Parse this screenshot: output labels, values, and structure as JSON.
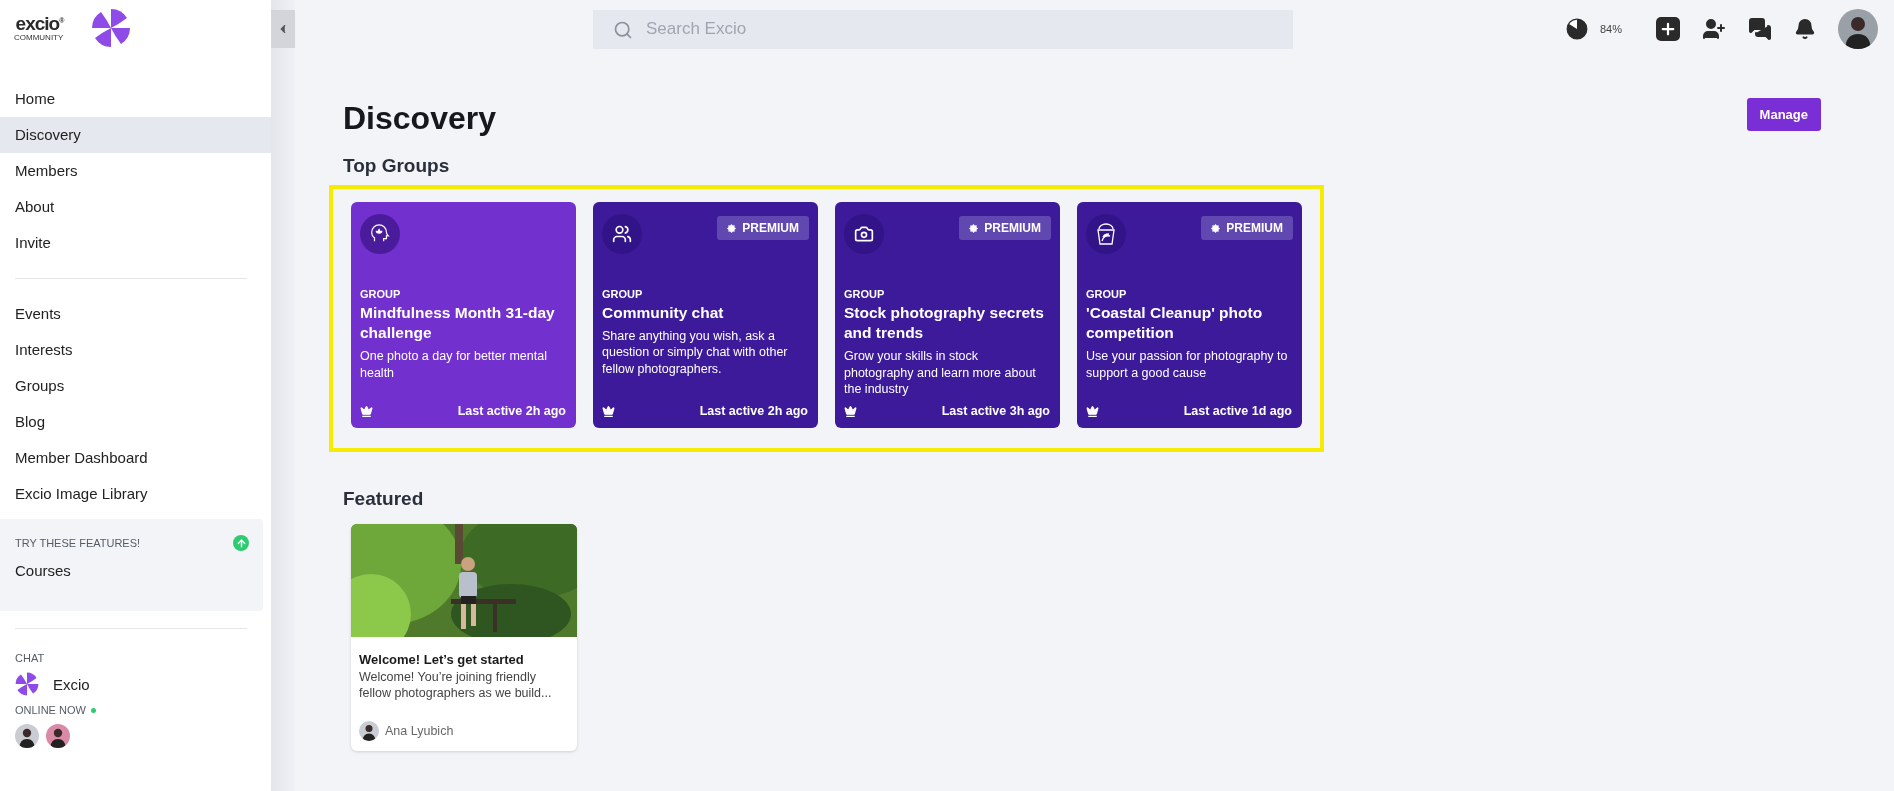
{
  "sidebar": {
    "logo": {
      "wordmark": "excio$^{®}$",
      "tagline": "COMMUNITY"
    },
    "nav_primary": [
      {
        "label": "Home",
        "selected": false
      },
      {
        "label": "Discovery",
        "selected": true
      },
      {
        "label": "Members",
        "selected": false
      },
      {
        "label": "About",
        "selected": false
      },
      {
        "label": "Invite",
        "selected": false
      }
    ],
    "nav_secondary": [
      {
        "label": "Events",
        "selected": false
      },
      {
        "label": "Interests",
        "selected": false
      },
      {
        "label": "Groups",
        "selected": false
      },
      {
        "label": "Blog",
        "selected": false
      },
      {
        "label": "Member Dashboard",
        "selected": false
      },
      {
        "label": "Excio Image Library",
        "selected": false
      }
    ],
    "features": {
      "heading": "TRY THESE FEATURES!",
      "items": [
        {
          "label": "Courses"
        }
      ]
    },
    "chat": {
      "heading": "CHAT",
      "channels": [
        {
          "name": "Excio"
        }
      ]
    },
    "online": {
      "heading": "ONLINE NOW"
    }
  },
  "topbar": {
    "search": {
      "placeholder": "Search Excio"
    },
    "storage": {
      "level": 0.84,
      "reading": "84%"
    }
  },
  "main": {
    "title": "Discovery",
    "manage_button": "Manage",
    "top_groups": {
      "heading": "Top Groups",
      "groups": [
        {
          "label": "GROUP",
          "title": "Mindfulness Month 31-day challenge",
          "description": "One photo a day for better mental health",
          "last_active": "Last active 2h ago"
        },
        {
          "label": "GROUP",
          "badge": "PREMIUM",
          "title": "Community chat",
          "description": "Share anything you wish, ask a question or simply chat with other fellow photographers.",
          "last_active": "Last active 2h ago"
        },
        {
          "label": "GROUP",
          "badge": "PREMIUM",
          "title": "Stock photography secrets and trends",
          "description": "Grow your skills in stock photography and learn more about the industry",
          "last_active": "Last active 3h ago"
        },
        {
          "label": "GROUP",
          "badge": "PREMIUM",
          "title": "'Coastal Cleanup' photo competition",
          "description": "Use your passion for photography to support a good cause",
          "last_active": "Last active 1d ago"
        }
      ]
    },
    "featured": {
      "heading": "Featured",
      "posts": [
        {
          "kind": "picture",
          "title": "Welcome! Let’s get started",
          "excerpt": "Welcome! You’re joining friendly fellow photographers as we build...",
          "author": "Ana Lyubich"
        }
      ]
    }
  }
}
